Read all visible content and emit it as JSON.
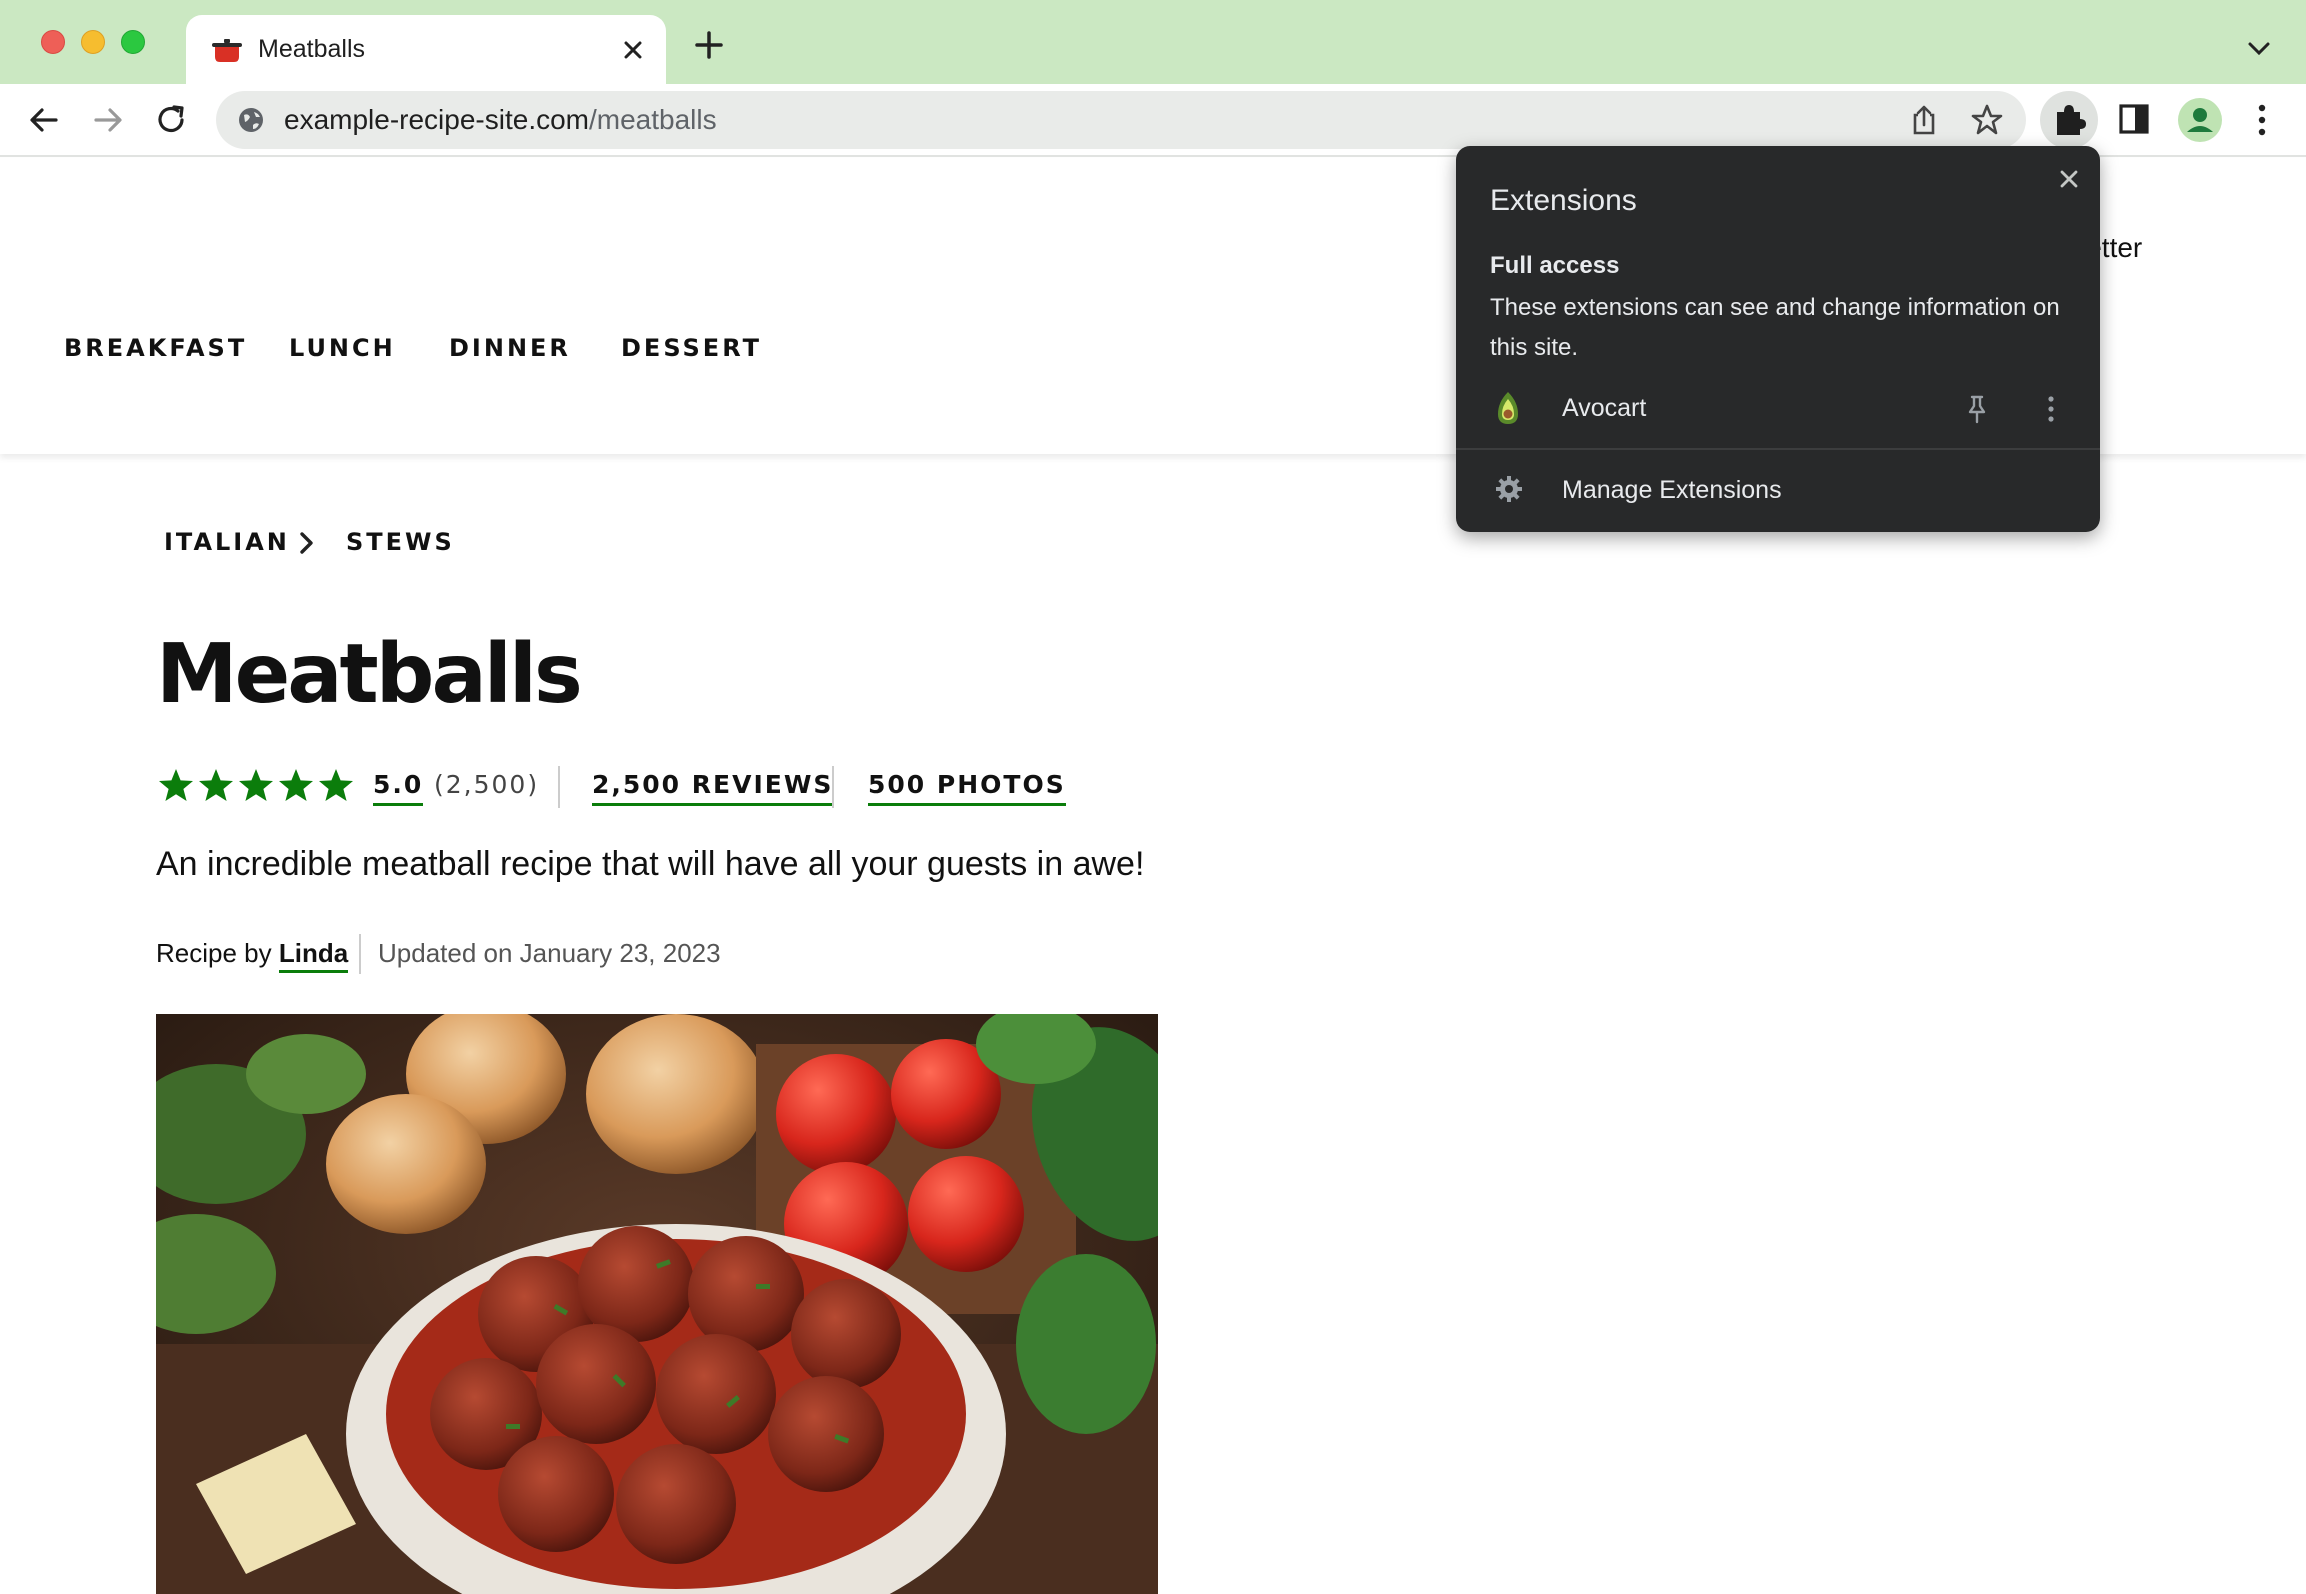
{
  "browser": {
    "tab": {
      "title": "Meatballs"
    },
    "address_bar": {
      "domain": "example-recipe-site.com",
      "path": "/meatballs"
    }
  },
  "site": {
    "nav": [
      "BREAKFAST",
      "LUNCH",
      "DINNER",
      "DESSERT"
    ],
    "header_right_fragment": "letter"
  },
  "recipe": {
    "breadcrumb": [
      "ITALIAN",
      "STEWS"
    ],
    "title": "Meatballs",
    "stars": 5,
    "rating_value": "5.0",
    "rating_count": "(2,500)",
    "reviews_link": "2,500 REVIEWS",
    "photos_link": "500 PHOTOS",
    "description": "An incredible meatball recipe that will have all your guests in awe!",
    "byline_prefix": "Recipe by",
    "author": "Linda",
    "updated": "Updated on January 23, 2023",
    "accent_color": "#0b7d0b"
  },
  "extensions_popup": {
    "title": "Extensions",
    "section_title": "Full access",
    "section_desc": "These extensions can see and change information on this site.",
    "items": [
      {
        "name": "Avocart",
        "icon": "avocado-icon"
      }
    ],
    "manage_label": "Manage Extensions"
  }
}
